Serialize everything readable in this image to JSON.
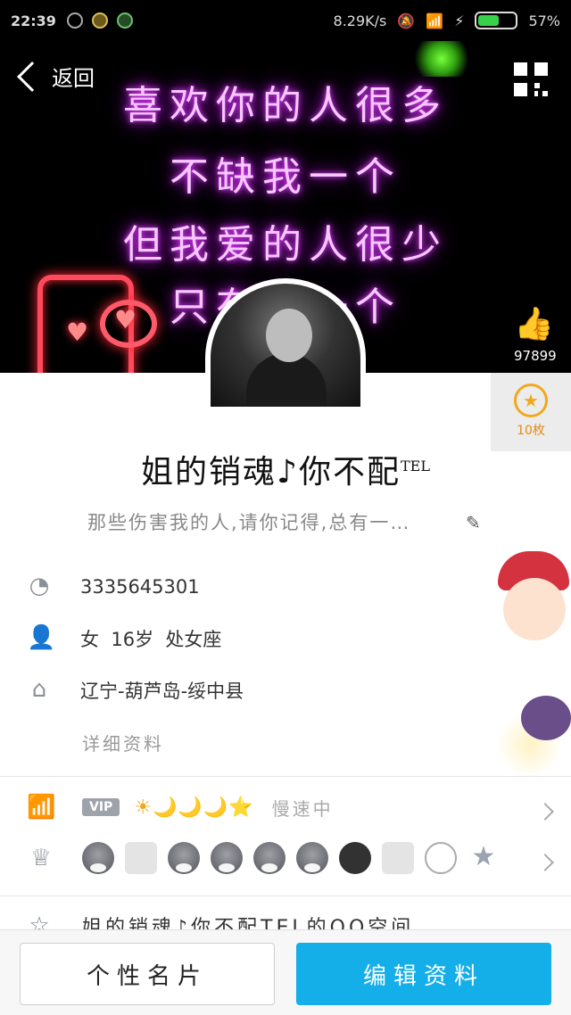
{
  "status_bar": {
    "time": "22:39",
    "net_speed": "8.29K/s",
    "battery": "57%",
    "battery_level": 0.57
  },
  "header": {
    "back_label": "返回",
    "banner_lines": [
      "喜欢你的人很多",
      "不缺我一个",
      "但我爱的人很少",
      "只有你一个"
    ]
  },
  "likes": {
    "count": "97899"
  },
  "coins": {
    "label": "10枚"
  },
  "profile": {
    "name": "姐的销魂♪你不配",
    "name_tag": "TEL",
    "signature": "那些伤害我的人,请你记得,总有一…"
  },
  "info": {
    "qq": "3335645301",
    "gender_age": "女  16岁  处女座",
    "location": "辽宁-葫芦岛-绥中县",
    "detail_link": "详细资料"
  },
  "level": {
    "vip_label": "VIP",
    "level_icons": "☀🌙🌙🌙⭐",
    "speed_text": "慢速中"
  },
  "space": {
    "label": "姐的销魂♪你不配TEL的QQ空间"
  },
  "buttons": {
    "card": "个性名片",
    "edit": "编辑资料"
  },
  "colors": {
    "accent": "#14aee9",
    "neon": "#e040ff",
    "coin": "#f0a91a"
  }
}
